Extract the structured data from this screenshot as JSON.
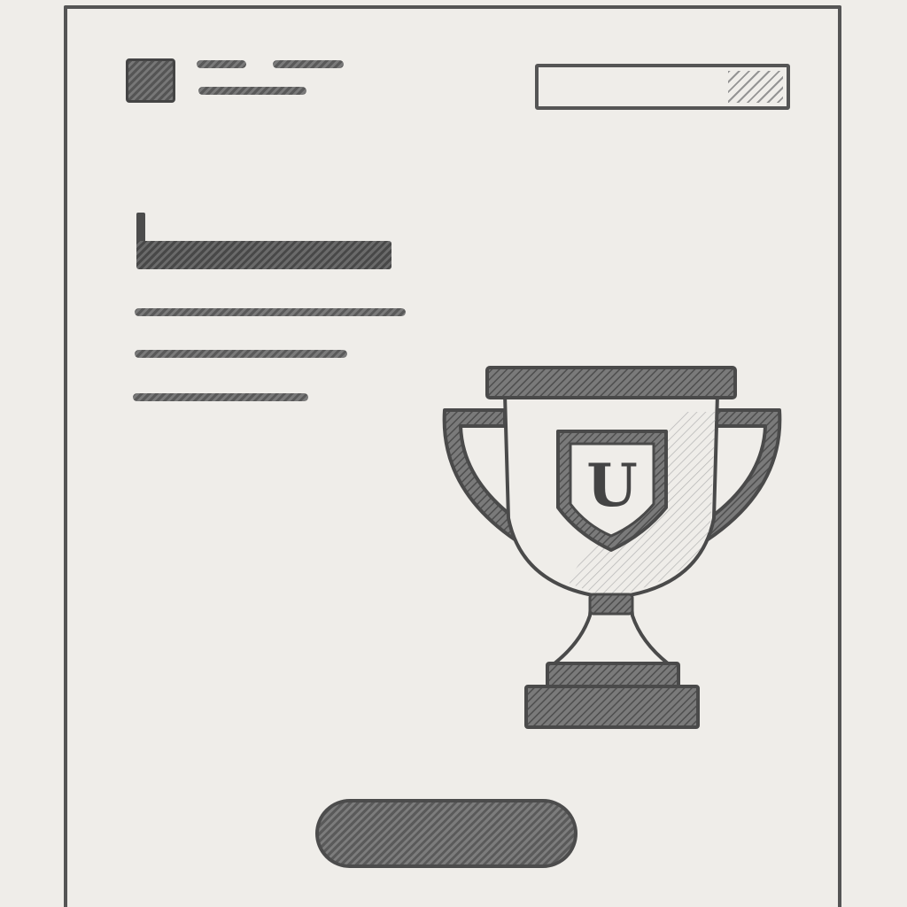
{
  "header": {
    "logo_icon": "logo-placeholder-icon",
    "title_placeholder": "",
    "subtitle_placeholder": ""
  },
  "search": {
    "icon": "search-icon",
    "value": "",
    "placeholder": ""
  },
  "main": {
    "heading": "",
    "lines": [
      "",
      "",
      ""
    ]
  },
  "trophy": {
    "icon": "trophy-icon",
    "emblem_letter": "U"
  },
  "cta": {
    "label": ""
  },
  "colors": {
    "paper": "#efede9",
    "ink": "#4a4a4a"
  }
}
